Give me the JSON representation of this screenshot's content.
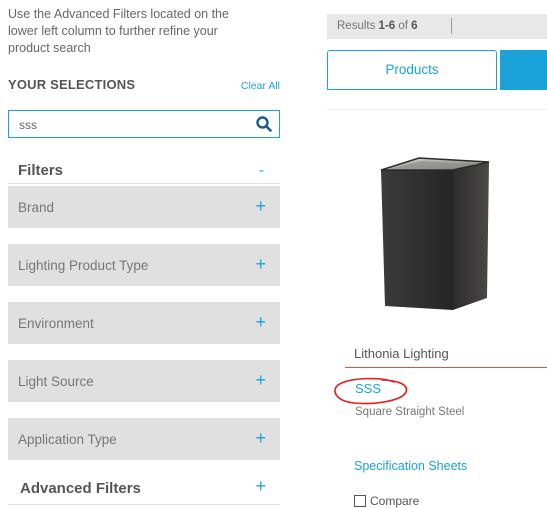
{
  "sidebar": {
    "intro_lines": [
      "Use the Advanced Filters located on the",
      "lower left column to further refine your",
      "product search"
    ],
    "selections_title": "YOUR SELECTIONS",
    "clear_all_label": "Clear All",
    "search_value": "sss",
    "search_icon": "search-icon",
    "filters_title": "Filters",
    "filters_toggle": "-",
    "filter_items": [
      {
        "label": "Brand",
        "toggle": "+"
      },
      {
        "label": "Lighting Product Type",
        "toggle": "+"
      },
      {
        "label": "Environment",
        "toggle": "+"
      },
      {
        "label": "Light Source",
        "toggle": "+"
      },
      {
        "label": "Application Type",
        "toggle": "+"
      }
    ],
    "advanced_filters_label": "Advanced Filters",
    "advanced_filters_toggle": "+"
  },
  "results": {
    "prefix": "Results ",
    "range": "1-6",
    "of": " of ",
    "total": "6"
  },
  "tabs": {
    "products_label": "Products"
  },
  "product": {
    "brand": "Lithonia Lighting",
    "name": "SSS",
    "description": "Square Straight Steel",
    "spec_sheets_label": "Specification Sheets",
    "compare_label": "Compare"
  },
  "colors": {
    "accent": "#1aa3d9",
    "filter_bg": "#e0e0e0",
    "annotation": "#e02020",
    "brand_underline": "#d9534f"
  }
}
